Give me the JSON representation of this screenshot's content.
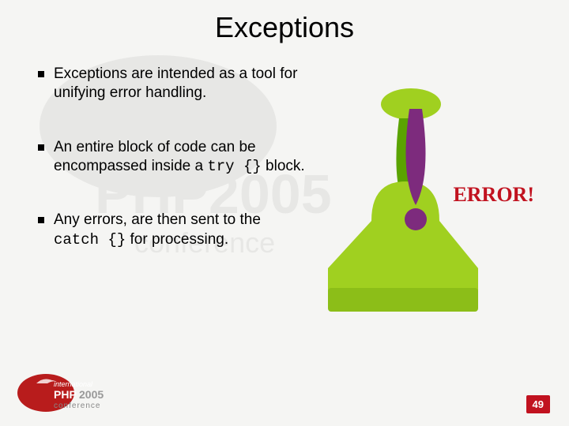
{
  "title": "Exceptions",
  "bullets": [
    {
      "pre": "Exceptions are intended as a tool for unifying error handling.",
      "code": "",
      "post": ""
    },
    {
      "pre": "An entire block of code can be encompassed inside a ",
      "code": "try {}",
      "post": " block."
    },
    {
      "pre": "Any errors, are then sent to the ",
      "code": "catch {}",
      "post": " for processing."
    }
  ],
  "error_label": "ERROR!",
  "page_number": "49",
  "logo": {
    "line1": "international",
    "line2_a": "PHP",
    "line2_b": "2005",
    "line3": "conference"
  }
}
